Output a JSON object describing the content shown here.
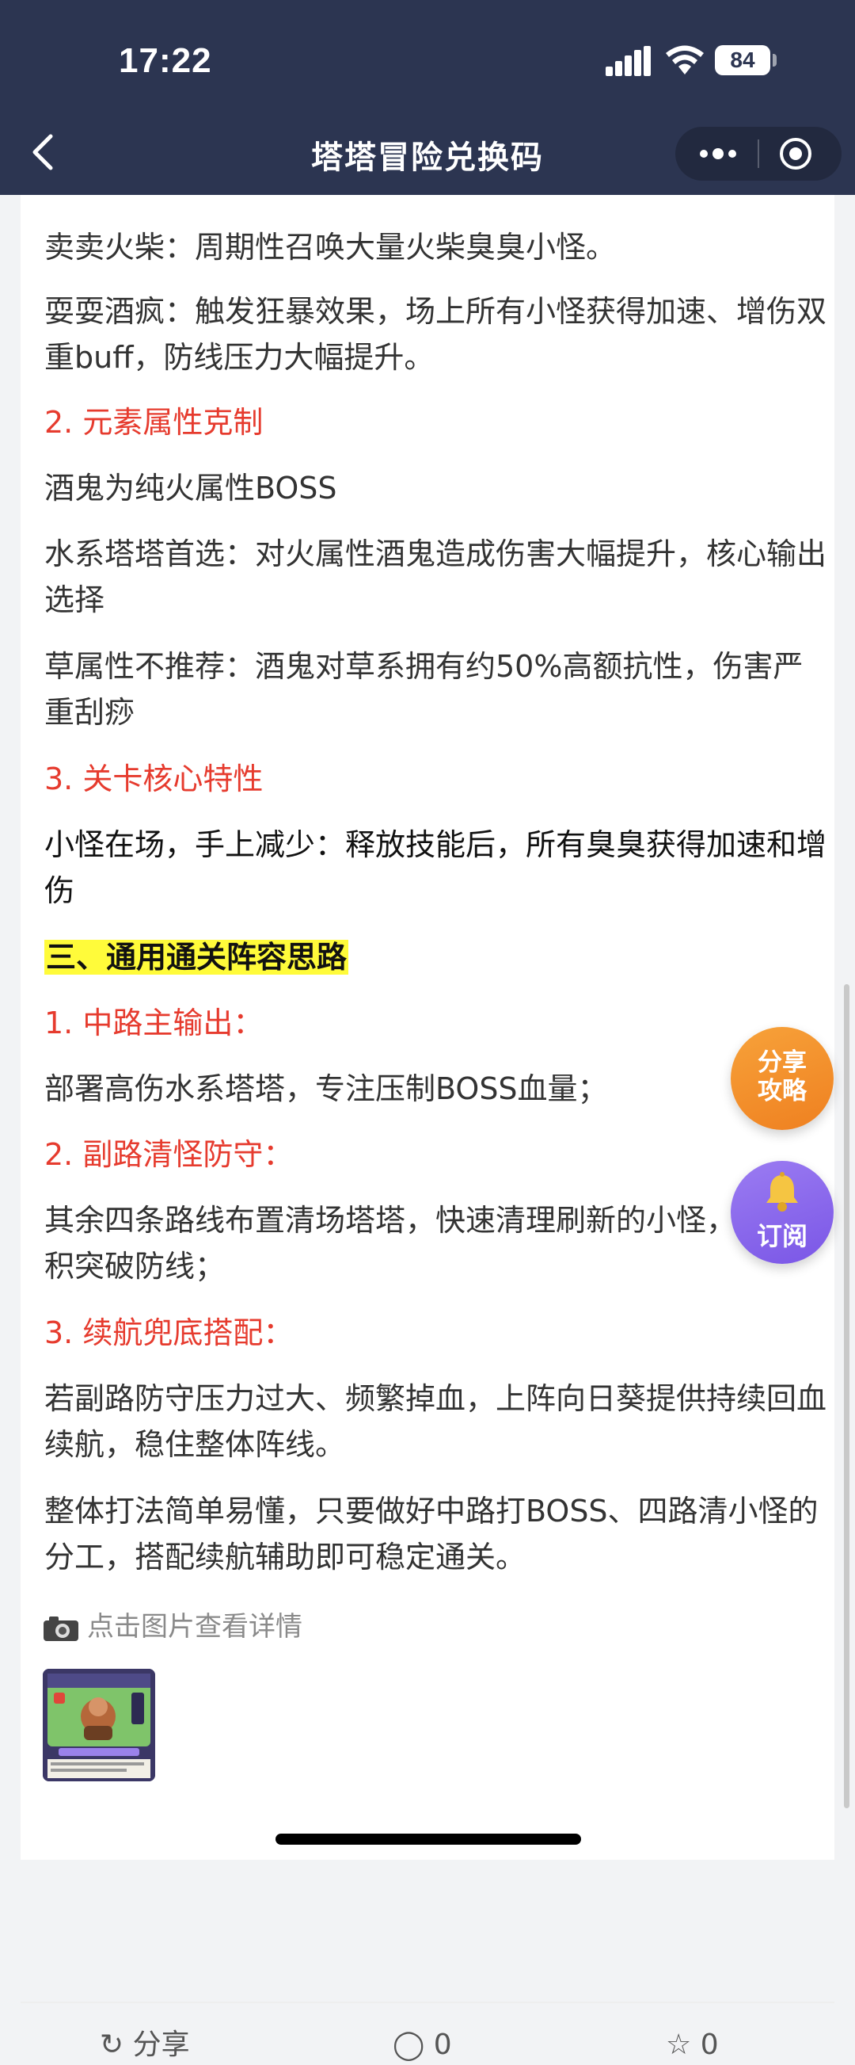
{
  "status_bar": {
    "time": "17:22",
    "battery": "84"
  },
  "nav": {
    "title": "塔塔冒险兑换码"
  },
  "article": {
    "paragraphs": [
      "卖卖火柴：周期性召唤大量火柴臭臭小怪。",
      "耍耍酒疯：触发狂暴效果，场上所有小怪获得加速、增伤双重buff，防线压力大幅提升。",
      "2. 元素属性克制",
      "酒鬼为纯火属性BOSS",
      "水系塔塔首选：对火属性酒鬼造成伤害大幅提升，核心输出选择",
      "草属性不推荐：酒鬼对草系拥有约50%高额抗性，伤害严重刮痧",
      "3. 关卡核心特性",
      "小怪在场，手上减少：释放技能后，所有臭臭获得加速和增伤",
      "三、通用通关阵容思路",
      "1. 中路主输出：",
      "部署高伤水系塔塔，专注压制BOSS血量；",
      "2. 副路清怪防守：",
      "其余四条路线布置清场塔塔，快速清理刷新的小怪，避免堆积突破防线；",
      "3. 续航兜底搭配：",
      "若副路防守压力过大、频繁掉血，上阵向日葵提供持续回血续航，稳住整体阵线。",
      "整体打法简单易懂，只要做好中路打BOSS、四路清小怪的分工，搭配续航辅助即可稳定通关。"
    ],
    "photo_tip": "点击图片查看详情"
  },
  "actions": {
    "share": "分享",
    "comment": "0",
    "like": "0"
  },
  "fab": {
    "share_line1": "分享",
    "share_line2": "攻略",
    "subscribe": "订阅"
  },
  "colors": {
    "header": "#2c3551",
    "section_red": "#e63b2e",
    "highlight": "#fffb3a",
    "fab_orange": "#f29030",
    "fab_purple": "#8a68ec"
  }
}
